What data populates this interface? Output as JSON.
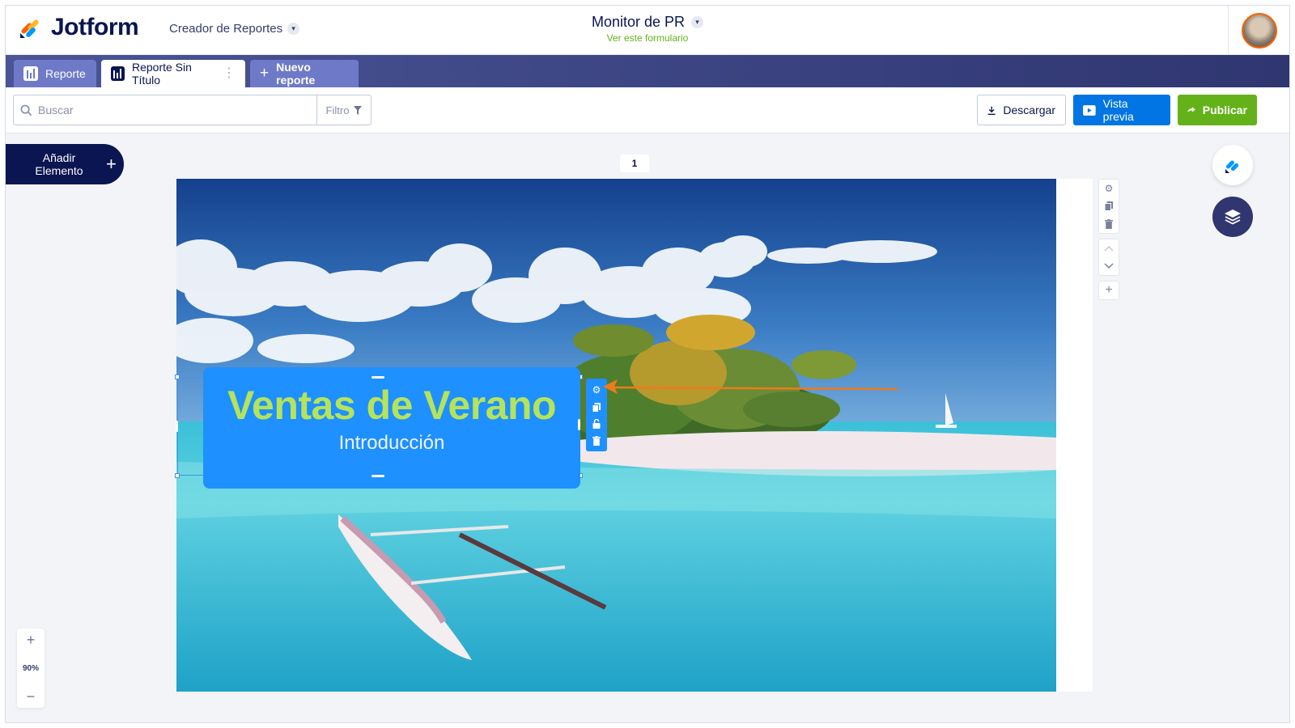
{
  "header": {
    "brand": "Jotform",
    "product": "Creador de Reportes",
    "form_title": "Monitor de PR",
    "form_link": "Ver este formulario"
  },
  "tabs": [
    {
      "label": "Reporte"
    },
    {
      "label": "Reporte Sin Título",
      "active": true
    },
    {
      "label": "Nuevo reporte"
    }
  ],
  "toolbar": {
    "search_placeholder": "Buscar",
    "filter_label": "Filtro",
    "download_label": "Descargar",
    "preview_label": "Vista previa",
    "publish_label": "Publicar"
  },
  "canvas": {
    "add_element_label": "Añadir Elemento",
    "page_number": "1",
    "zoom_level": "90%"
  },
  "text_element": {
    "title": "Ventas de Verano",
    "subtitle": "Introducción",
    "title_color": "#b5e35a",
    "background_color": "#1e90ff"
  },
  "colors": {
    "brand_navy": "#0a1551",
    "preview_blue": "#0075e3",
    "publish_green": "#64b21a",
    "annotation_arrow": "#f07a1a"
  }
}
